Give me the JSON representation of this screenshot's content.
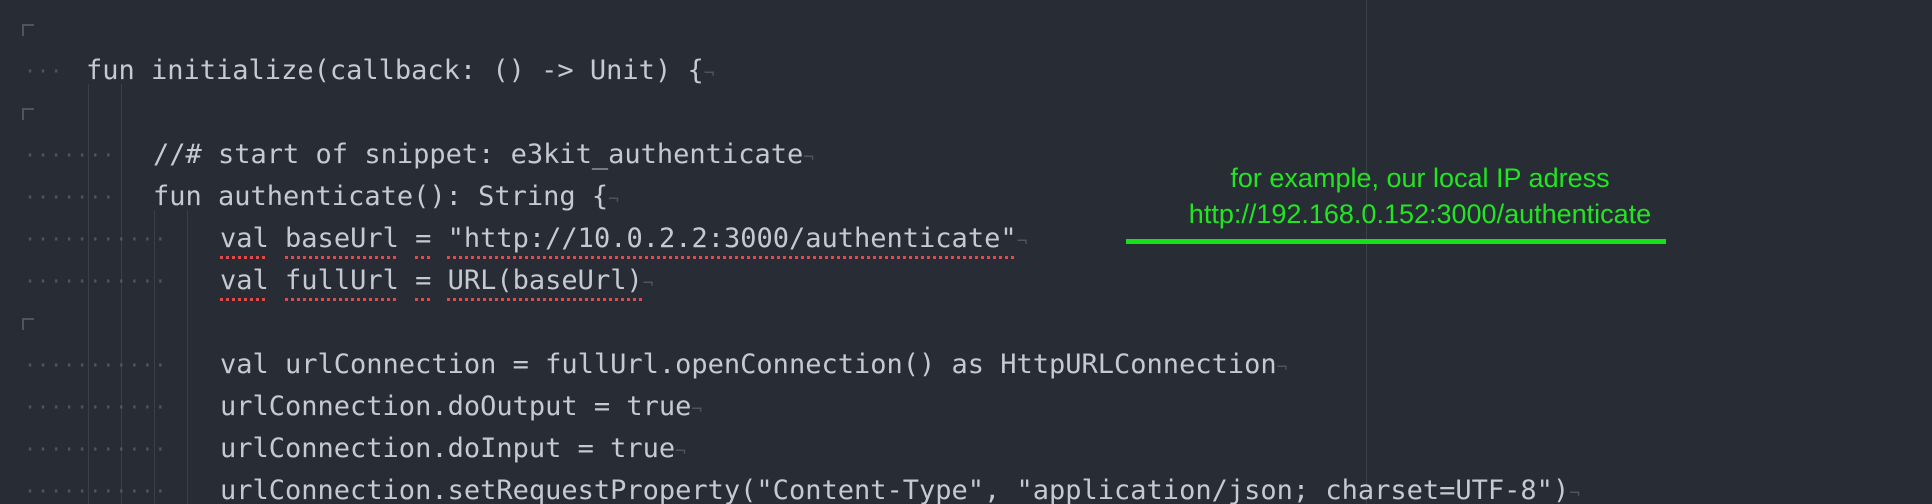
{
  "editor": {
    "lines": [
      {
        "indent": 0,
        "text": ""
      },
      {
        "indent": 1,
        "text": "fun initialize(callback: () -> Unit) {"
      },
      {
        "indent": 0,
        "text": ""
      },
      {
        "indent": 2,
        "text": "//# start of snippet: e3kit_authenticate"
      },
      {
        "indent": 2,
        "text": "fun authenticate(): String {"
      },
      {
        "indent": 3,
        "segments": [
          "val",
          " ",
          "baseUrl",
          " ",
          "=",
          " ",
          "\"http://10.0.2.2:3000/authenticate\""
        ]
      },
      {
        "indent": 3,
        "segments": [
          "val",
          " ",
          "fullUrl",
          " ",
          "=",
          " ",
          "URL(baseUrl)"
        ]
      },
      {
        "indent": 0,
        "text": ""
      },
      {
        "indent": 3,
        "text": "val urlConnection = fullUrl.openConnection() as HttpURLConnection"
      },
      {
        "indent": 3,
        "text": "urlConnection.doOutput = true"
      },
      {
        "indent": 3,
        "text": "urlConnection.doInput = true"
      },
      {
        "indent": 3,
        "text": "urlConnection.setRequestProperty(\"Content-Type\", \"application/json; charset=UTF-8\")"
      }
    ],
    "eol_marker": "¬",
    "whitespace_dot": "·"
  },
  "annotation": {
    "line1": "for example, our local IP adress",
    "line2": "http://192.168.0.152:3000/authenticate",
    "color": "#22e522"
  },
  "colors": {
    "background": "#282c34",
    "code_text": "#c5c9d1",
    "invisibles": "#4f545e",
    "error_underline": "#e04a4a"
  }
}
